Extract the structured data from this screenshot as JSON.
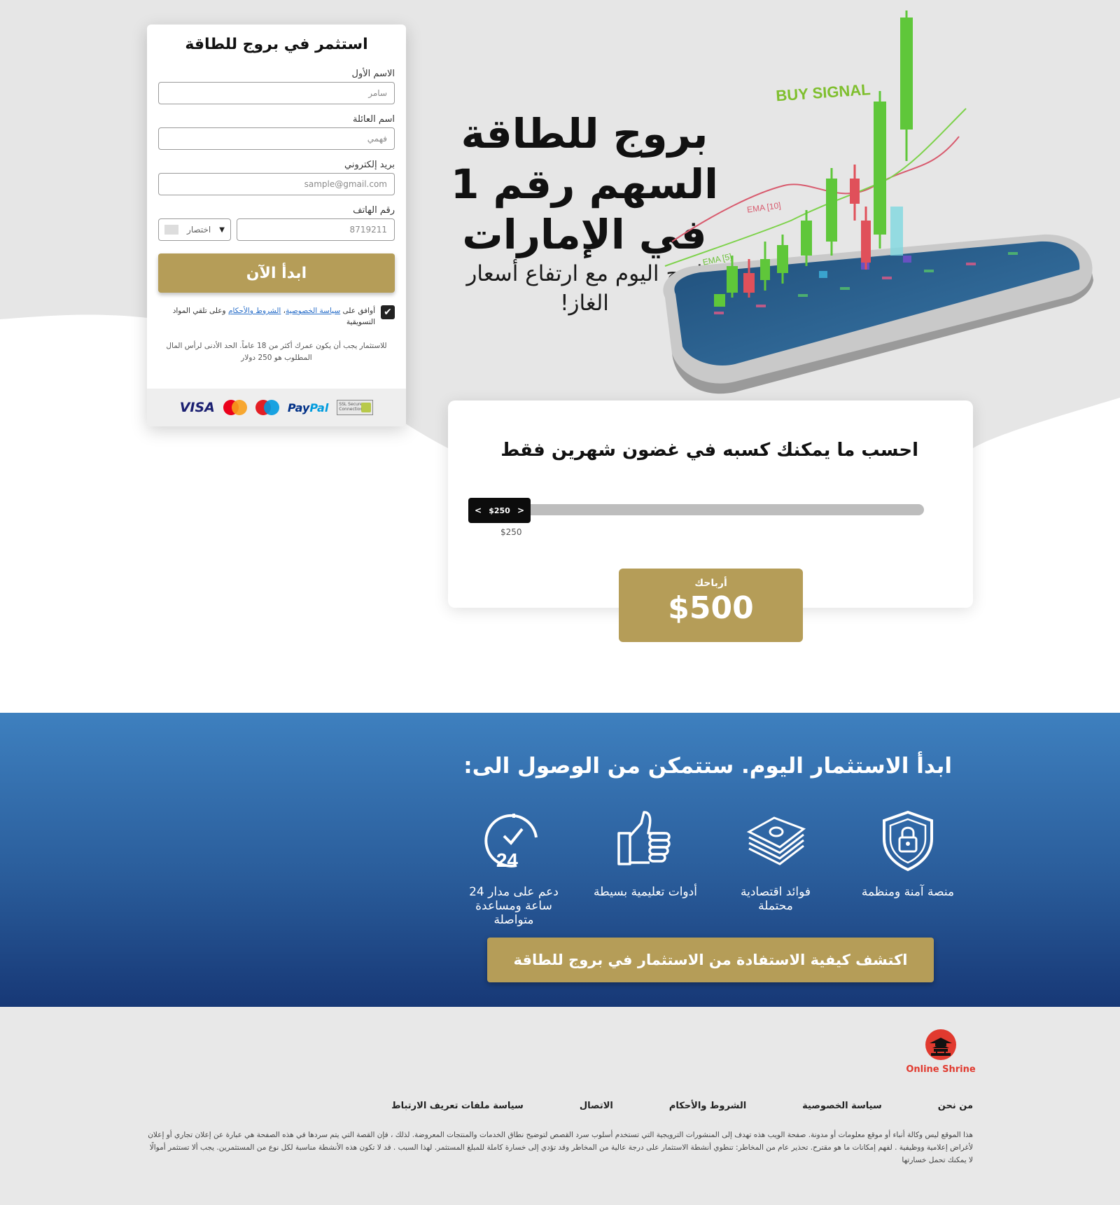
{
  "hero": {
    "headline": "بروج للطاقة السهم رقم 1 في الإمارات",
    "subline": "اربح اليوم مع ارتفاع أسعار الغاز!",
    "chart_labels": {
      "buy_signal": "BUY SIGNAL",
      "ema10": "EMA [10]",
      "ema5": "EMA [5]"
    }
  },
  "form": {
    "title": "استثمر في بروج للطاقة",
    "first_name": {
      "label": "الاسم الأول",
      "placeholder": "سامر"
    },
    "last_name": {
      "label": "اسم العائلة",
      "placeholder": "فهمي"
    },
    "email": {
      "label": "بريد إلكتروني",
      "placeholder": "sample@gmail.com"
    },
    "phone": {
      "label": "رقم الهاتف",
      "placeholder": "8719211",
      "prefix": "اختصار"
    },
    "submit_label": "ابدأ الآن",
    "consent": {
      "checked": true,
      "prefix": "أوافق على",
      "privacy_link": "سياسة الخصوصية",
      "separator": "،",
      "terms_link": "الشروط والأحكام",
      "suffix": "وعلى تلقي المواد التسويقية"
    },
    "note": "للاستثمار يجب أن يكون عمرك أكثر من 18 عاماً. الحد الأدنى لرأس المال المطلوب هو 250 دولار",
    "payments": {
      "visa": "VISA",
      "mastercard": "mastercard",
      "maestro": "maestro",
      "paypal_a": "Pay",
      "paypal_b": "Pal",
      "ssl": "SSL Secure Connection"
    }
  },
  "calculator": {
    "title": "احسب ما يمكنك كسبه في غضون شهرين فقط",
    "slider_value": "$250",
    "slider_min": "$250",
    "slider_fraction": 0,
    "profit_label": "أرباحك",
    "profit_value": "$500"
  },
  "benefits": {
    "title": "ابدأ الاستثمار اليوم. ستتمكن من الوصول الى:",
    "items": [
      {
        "label": "منصة آمنة ومنظمة",
        "icon": "shield-lock-icon"
      },
      {
        "label": "فوائد اقتصادية محتملة",
        "icon": "money-stack-icon"
      },
      {
        "label": "أدوات تعليمية بسيطة",
        "icon": "thumbs-up-icon"
      },
      {
        "label": "دعم على مدار 24 ساعة ومساعدة متواصلة",
        "icon": "clock-24-icon"
      }
    ],
    "cta_label": "اكتشف كيفية الاستفادة من الاستثمار في بروج للطاقة"
  },
  "footer": {
    "logo_text": "Online Shrine",
    "links": [
      "من نحن",
      "سياسة الخصوصية",
      "الشروط والأحكام",
      "الاتصال",
      "سياسة ملفات تعريف الارتباط"
    ],
    "disclaimer": "هذا الموقع ليس وكالة أنباء أو موقع معلومات أو مدونة. صفحة الويب هذه تهدف إلى المنشورات الترويجية التي تستخدم أسلوب سرد القصص لتوضيح نطاق الخدمات والمنتجات المعروضة. لذلك ، فإن القصة التي يتم سردها في هذه الصفحة هي عبارة عن إعلان تجاري أو إعلان لأغراض إعلامية ووظيفية . لفهم إمكانات ما هو مقترح. تحذير عام من المخاطر: تنطوي أنشطة الاستثمار على درجة عالية من المخاطر وقد تؤدي إلى خسارة كاملة للمبلغ المستثمر. لهذا السبب . قد لا تكون هذه الأنشطة مناسبة لكل نوع من المستثمرين. يجب ألا تستثمر أموالًا لا يمكنك تحمل خسارتها"
  },
  "colors": {
    "gold": "#b59d58",
    "blue_top": "#3e80bf",
    "blue_bottom": "#173876",
    "hero_gray": "#e6e6e6",
    "logo_red": "#e13a2f"
  }
}
